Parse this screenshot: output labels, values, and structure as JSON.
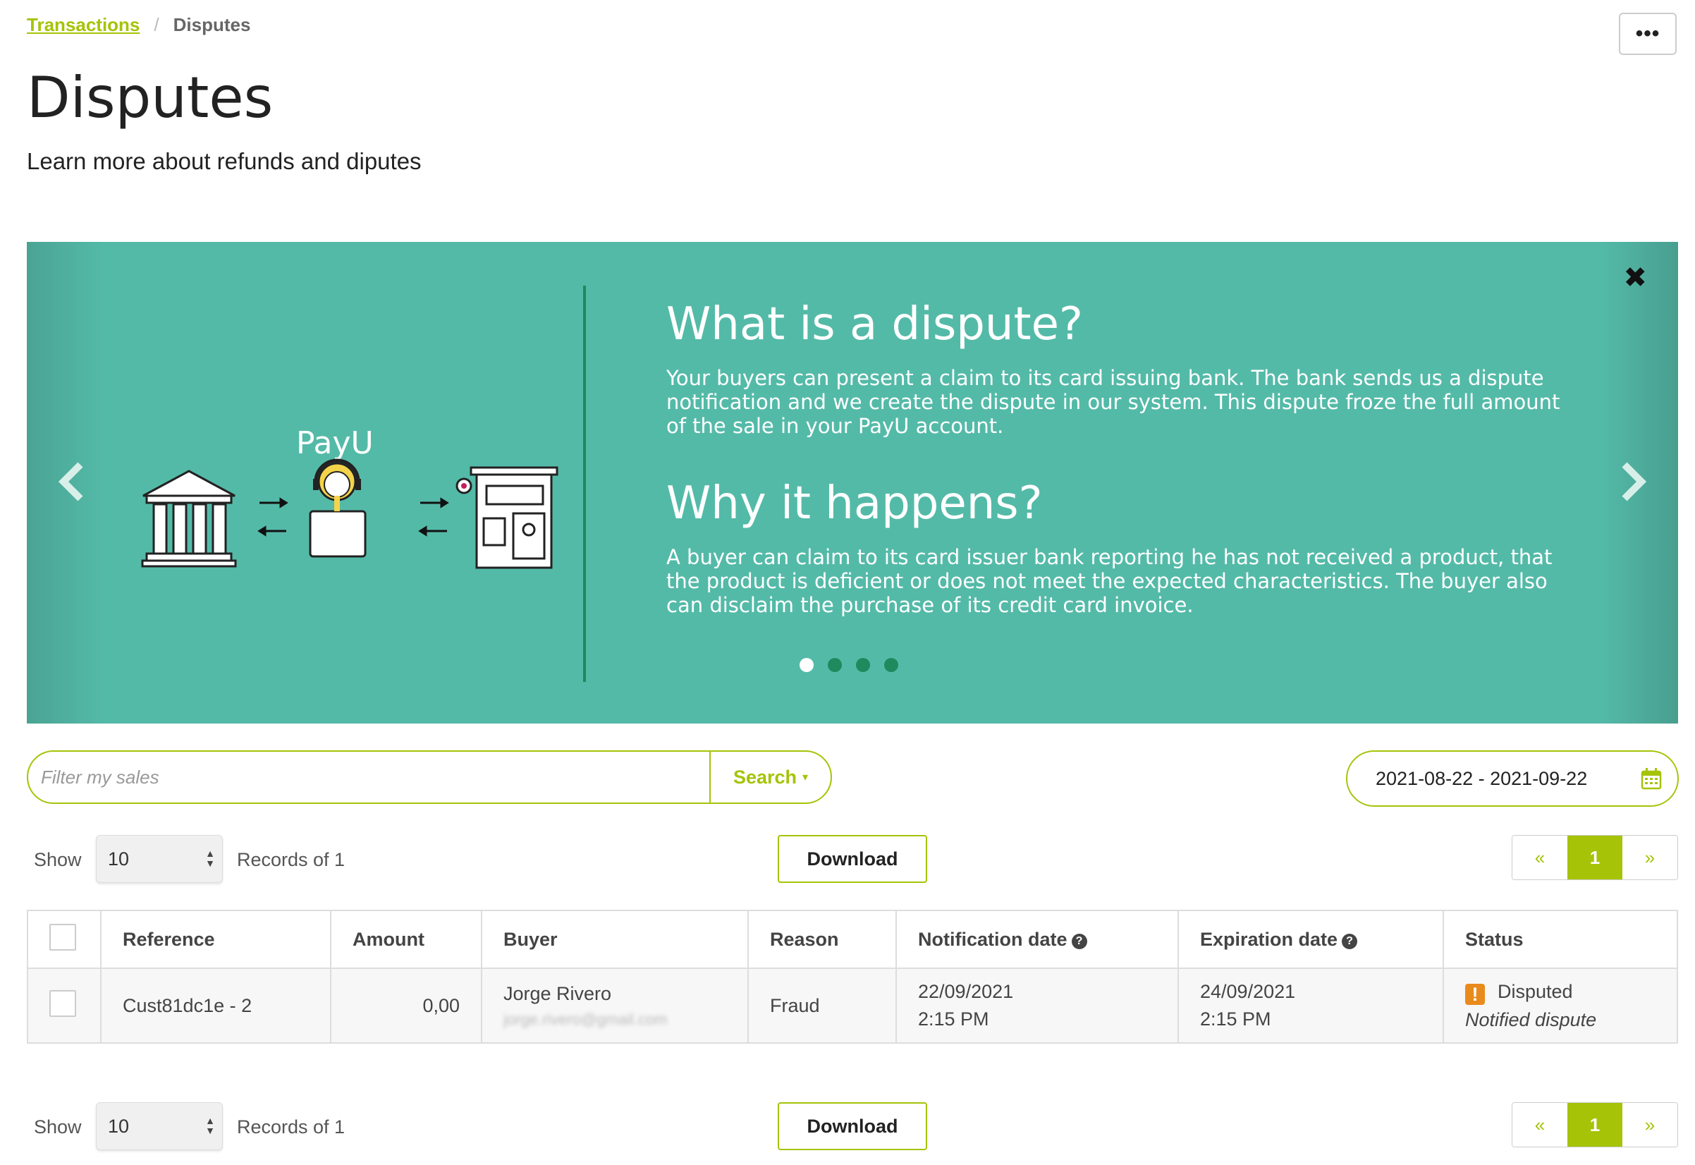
{
  "breadcrumb": {
    "parent": "Transactions",
    "current": "Disputes",
    "separator": "/"
  },
  "more_button": "•••",
  "page": {
    "title": "Disputes",
    "subtitle": "Learn more about refunds and diputes"
  },
  "banner": {
    "close": "✖",
    "logo_text": "PayU",
    "heading1": "What is a dispute?",
    "text1": "Your buyers can present a claim to its card issuing bank. The bank sends us a dispute notification and we create the dispute in our system. This dispute froze the full amount of the sale in your PayU account.",
    "heading2": "Why it happens?",
    "text2": "A buyer can claim to its card issuer bank reporting he has not received a product, that the product is deficient or does not meet the expected characteristics. The buyer also can disclaim the purchase of its credit card invoice.",
    "slide_count": 4,
    "active_slide": 1,
    "colors": {
      "background": "#54baa8",
      "accent": "#1e8a5e"
    }
  },
  "search": {
    "placeholder": "Filter my sales",
    "button": "Search",
    "caret": "▾"
  },
  "date_range": {
    "value": "2021-08-22 - 2021-09-22",
    "icon": "calendar-icon"
  },
  "controls": {
    "show_label": "Show",
    "page_size": "10",
    "records_label": "Records of 1",
    "download": "Download",
    "pager": {
      "first": "«",
      "current": "1",
      "last": "»"
    }
  },
  "table": {
    "headers": [
      "Reference",
      "Amount",
      "Buyer",
      "Reason",
      "Notification date",
      "Expiration date",
      "Status"
    ],
    "rows": [
      {
        "reference": "Cust81dc1e - 2",
        "amount": "0,00",
        "buyer_name": "Jorge Rivero",
        "buyer_email": "jorge.rivero@gmail.com",
        "reason": "Fraud",
        "notification_date": "22/09/2021",
        "notification_time": "2:15 PM",
        "expiration_date": "24/09/2021",
        "expiration_time": "2:15 PM",
        "status": "Disputed",
        "status_detail": "Notified dispute",
        "status_icon": "!"
      }
    ]
  },
  "colors": {
    "brand": "#a6c307",
    "warning": "#e98b1c"
  }
}
